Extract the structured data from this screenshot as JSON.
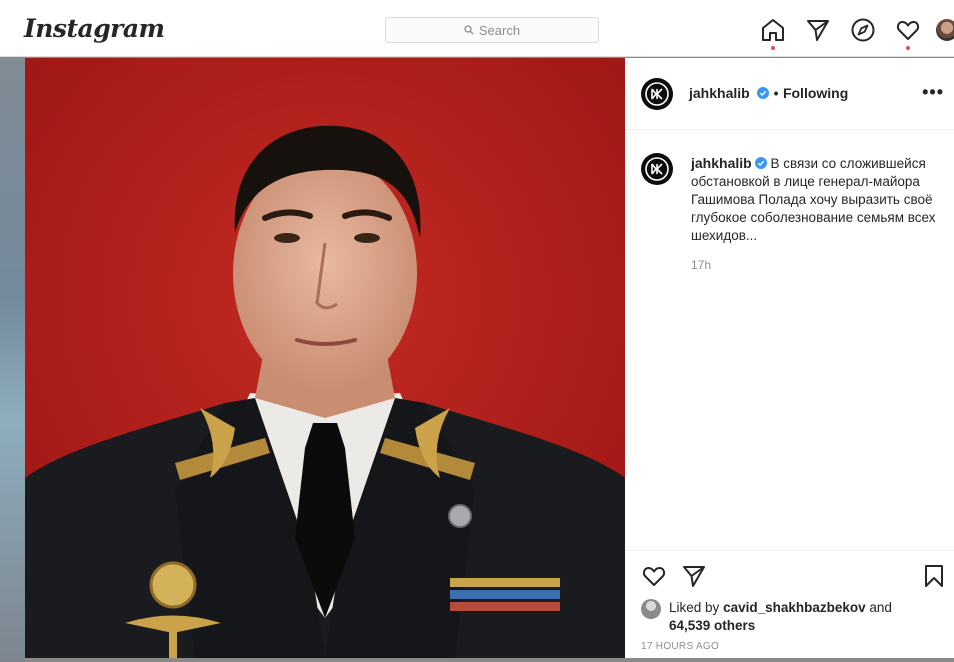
{
  "app": {
    "logo_text": "Instagram"
  },
  "search": {
    "placeholder": "Search"
  },
  "nav": {
    "items": [
      {
        "name": "home",
        "icon": "home-icon"
      },
      {
        "name": "direct",
        "icon": "paper-plane-icon"
      },
      {
        "name": "explore",
        "icon": "compass-icon"
      },
      {
        "name": "activity",
        "icon": "heart-icon"
      },
      {
        "name": "profile",
        "icon": "avatar"
      }
    ],
    "notification_color": "#ed4956"
  },
  "post": {
    "header": {
      "username": "jahkhalib",
      "separator": "•",
      "follow_status": "Following",
      "more_label": "•••"
    },
    "caption": {
      "username": "jahkhalib",
      "text": "В связи со сложившейся обстановкой в лице генерал-майора Гашимова Полада хочу выразить своё глубокое соболезнование семьям всех шехидов..."
    },
    "time_ago": "17h",
    "likes": {
      "prefix": "Liked by",
      "liker": "cavid_shakhbazbekov",
      "joiner": "and",
      "others": "64,539 others"
    },
    "date": "17 HOURS AGO",
    "icons": [
      "heart-icon",
      "share-icon",
      "bookmark-icon"
    ]
  },
  "colors": {
    "photo_background": "#b51f1c",
    "verified_blue": "#3897f0",
    "text_primary": "#262626",
    "text_secondary": "#8e8e8e"
  }
}
